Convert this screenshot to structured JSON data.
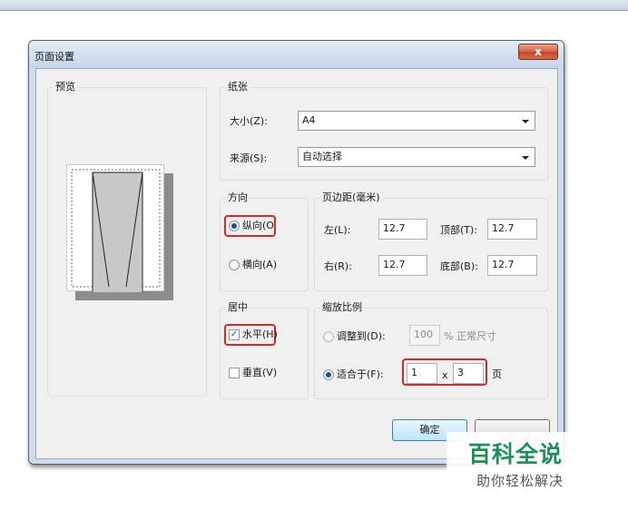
{
  "dialog": {
    "title": "页面设置",
    "close_glyph": "x"
  },
  "preview": {
    "legend": "预览"
  },
  "paper": {
    "legend": "纸张",
    "size_label": "大小(Z):",
    "size_value": "A4",
    "source_label": "来源(S):",
    "source_value": "自动选择"
  },
  "orientation": {
    "legend": "方向",
    "portrait_label": "纵向(O",
    "portrait_checked": true,
    "landscape_label": "横向(A)",
    "landscape_checked": false
  },
  "margins": {
    "legend": "页边距(毫米)",
    "left_label": "左(L):",
    "left_value": "12.7",
    "top_label": "顶部(T):",
    "top_value": "12.7",
    "right_label": "右(R):",
    "right_value": "12.7",
    "bottom_label": "底部(B):",
    "bottom_value": "12.7"
  },
  "centering": {
    "legend": "居中",
    "horizontal_label": "水平(H)",
    "horizontal_checked": true,
    "vertical_label": "垂直(V)",
    "vertical_checked": false
  },
  "scaling": {
    "legend": "缩放比例",
    "adjust_label": "调整到(D):",
    "adjust_value": "100",
    "adjust_suffix": "% 正常尺寸",
    "fit_label": "适合于(F):",
    "fit_wide": "1",
    "fit_x": "x",
    "fit_tall": "3",
    "fit_suffix": "页"
  },
  "buttons": {
    "ok_label": "确定",
    "cancel_label": ""
  },
  "watermark": {
    "title": "百科全说",
    "subtitle": "助你轻松解决"
  },
  "colors": {
    "highlight": "#d42a2a",
    "watermark_green": "#1e8f57"
  }
}
